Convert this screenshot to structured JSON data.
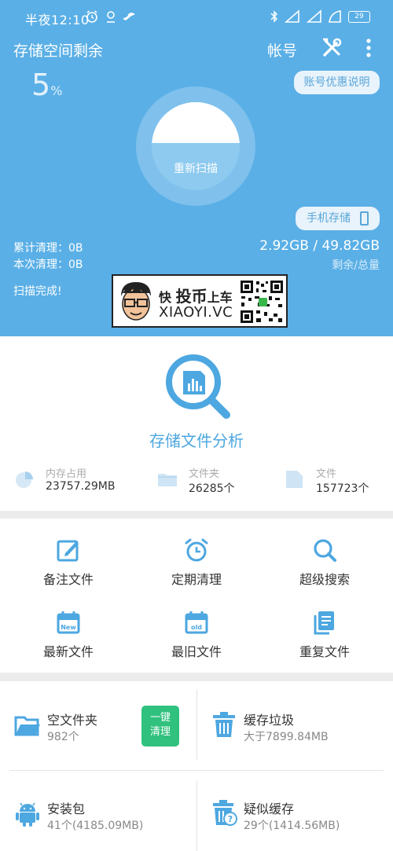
{
  "status_bar": {
    "time": "半夜12:10",
    "battery": "29"
  },
  "header": {
    "title": "存储空间剩余",
    "account_label": "帐号",
    "percent_value": "5",
    "percent_sign": "%",
    "promo_button": "账号优惠说明",
    "rescan_label": "重新扫描",
    "phone_storage_button": "手机存储",
    "cumulative_clean": "累计清理：0B",
    "current_clean": "本次清理：0B",
    "storage_value": "2.92GB / 49.82GB",
    "storage_label": "剩余/总量",
    "scan_status": "扫描完成!",
    "remaining_fraction": 0.0586
  },
  "watermark": {
    "line1_a": "快",
    "line1_b": "投币",
    "line1_c": "上车",
    "line2": "XIAOYI.VC"
  },
  "analysis": {
    "title": "存储文件分析",
    "metrics": [
      {
        "label": "内存占用",
        "value": "23757.29MB",
        "icon": "pie-chart-icon"
      },
      {
        "label": "文件夹",
        "value": "26285个",
        "icon": "folder-icon"
      },
      {
        "label": "文件",
        "value": "157723个",
        "icon": "file-icon"
      }
    ]
  },
  "tools": [
    {
      "label": "备注文件",
      "icon": "edit-note-icon"
    },
    {
      "label": "定期清理",
      "icon": "alarm-clock-icon"
    },
    {
      "label": "超级搜索",
      "icon": "search-icon"
    },
    {
      "label": "最新文件",
      "icon": "calendar-new-icon",
      "badge": "New"
    },
    {
      "label": "最旧文件",
      "icon": "calendar-old-icon",
      "badge": "old"
    },
    {
      "label": "重复文件",
      "icon": "duplicate-files-icon"
    }
  ],
  "cards": [
    {
      "title": "空文件夹",
      "sub": "982个",
      "icon": "folder-open-icon",
      "button": "一键\n清理"
    },
    {
      "title": "缓存垃圾",
      "sub": "大于7899.84MB",
      "icon": "trash-icon"
    },
    {
      "title": "安装包",
      "sub": "41个(4185.09MB)",
      "icon": "android-icon"
    },
    {
      "title": "疑似缓存",
      "sub": "29个(1414.56MB)",
      "icon": "trash-question-icon"
    }
  ],
  "colors": {
    "header_blue": "#5aafe6",
    "accent_blue": "#4da7e0",
    "button_green": "#2fc17d"
  }
}
